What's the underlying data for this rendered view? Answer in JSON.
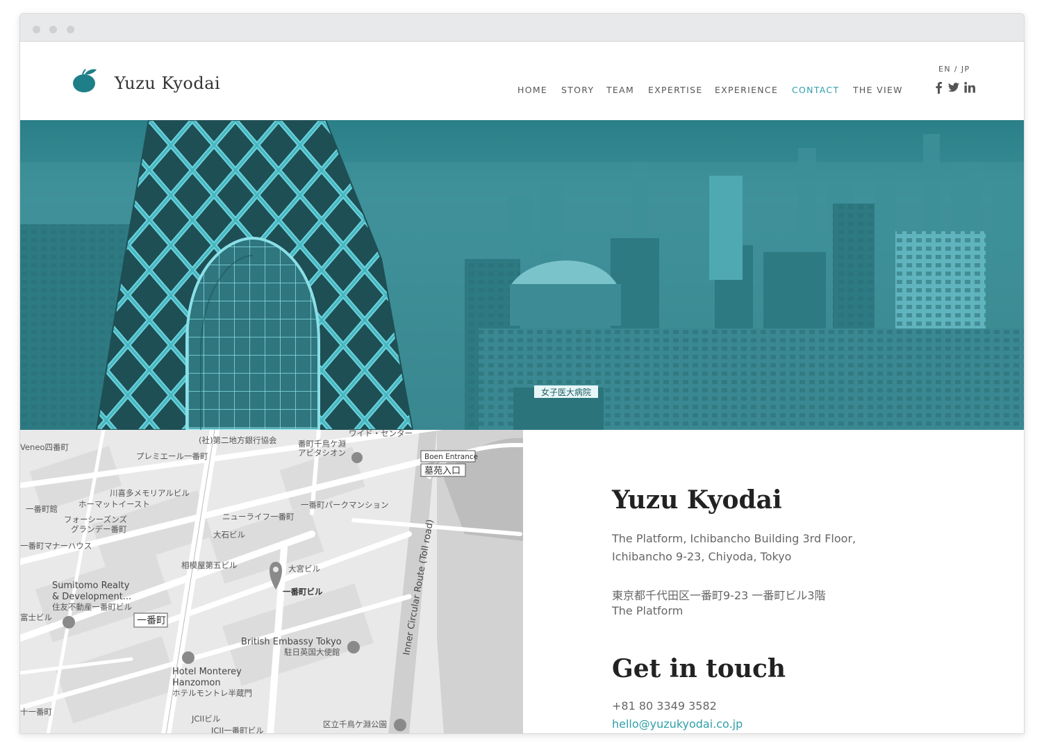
{
  "brand": {
    "name": "Yuzu Kyodai",
    "accent_color": "#2f9fa8",
    "logo_color": "#1f7f89"
  },
  "nav": {
    "items": [
      {
        "label": "HOME",
        "active": false
      },
      {
        "label": "STORY",
        "active": false
      },
      {
        "label": "TEAM",
        "active": false
      },
      {
        "label": "EXPERTISE",
        "active": false
      },
      {
        "label": "EXPERIENCE",
        "active": false
      },
      {
        "label": "CONTACT",
        "active": true
      },
      {
        "label": "THE VIEW",
        "active": false
      }
    ],
    "language": "EN / JP",
    "social_icons": [
      "facebook-icon",
      "twitter-icon",
      "linkedin-icon"
    ]
  },
  "hero": {
    "tint_color": "#2f8790",
    "sign_text": "女子医大病院"
  },
  "map": {
    "labels": [
      "(社)第二地方銀行協会",
      "ワイド・センター",
      "Veneo四番町",
      "番町千鳥ケ淵",
      "アビタシオン",
      "プレミエール一番町",
      "Boen Entrance",
      "墓苑入口",
      "川喜多メモリアルビル",
      "ホーマットイースト",
      "一番町館",
      "一番町パークマンション",
      "フォーシーズンズ",
      "グランデー番町",
      "ニューライフ一番町",
      "一番町マナーハウス",
      "大石ビル",
      "相模屋第五ビル",
      "大宮ビル",
      "一番町ビル",
      "Sumitomo Realty",
      "& Development...",
      "住友不動産一番町ビル",
      "富士ビル",
      "一番町",
      "Inner Circular Route (Toll road)",
      "British Embassy Tokyo",
      "駐日英国大使館",
      "Hotel Monterey",
      "Hanzomon",
      "ホテルモントレ半蔵門",
      "JCIIビル",
      "JCII一番町ビル",
      "区立千鳥ケ淵公園",
      "十一番町"
    ]
  },
  "contact": {
    "title": "Yuzu Kyodai",
    "address_en_1": "The Platform, Ichibancho Building 3rd Floor,",
    "address_en_2": "Ichibancho 9-23, Chiyoda, Tokyo",
    "address_jp_1": "東京都千代田区一番町9-23 一番町ビル3階",
    "address_jp_2": "The Platform",
    "get_in_touch": "Get in touch",
    "phone": "+81 80 3349 3582",
    "email": "hello@yuzukyodai.co.jp"
  }
}
